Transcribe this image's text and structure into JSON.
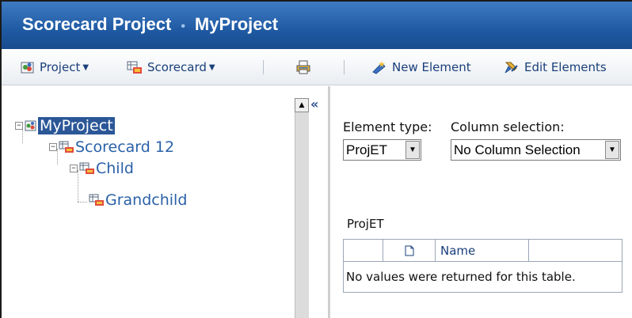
{
  "title": {
    "left": "Scorecard Project",
    "separator": "•",
    "right": "MyProject"
  },
  "toolbar": {
    "project_label": "Project",
    "scorecard_label": "Scorecard",
    "new_element_label": "New Element",
    "edit_elements_label": "Edit Elements"
  },
  "tree": {
    "root": "MyProject",
    "scorecard": "Scorecard 12",
    "child": "Child",
    "grandchild": "Grandchild"
  },
  "panel": {
    "collapse_glyph": "«"
  },
  "filters": {
    "element_type_label": "Element type:",
    "element_type_value": "ProjET",
    "column_selection_label": "Column selection:",
    "column_selection_value": "No Column Selection"
  },
  "table": {
    "title": "ProjET",
    "columns": [
      "",
      "Name"
    ],
    "empty_message": "No values were returned for this table."
  },
  "colors": {
    "title_bar": "#1f5aa3",
    "selection": "#2b5797",
    "link": "#2a61a8"
  }
}
